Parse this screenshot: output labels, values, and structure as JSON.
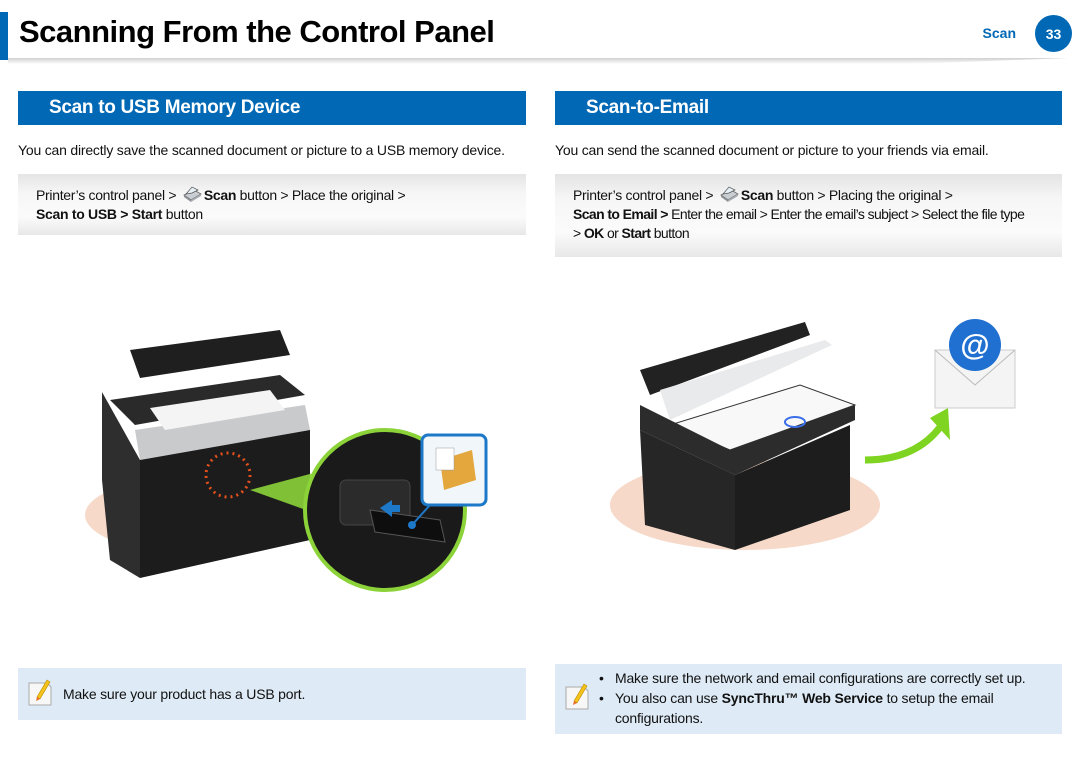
{
  "header": {
    "title": "Scanning From the Control Panel",
    "section": "Scan",
    "page_number": "33",
    "accent_color": "#0068b4"
  },
  "left": {
    "heading": "Scan to USB Memory Device",
    "intro": "You can directly save the scanned document or picture to a USB memory device.",
    "steps": {
      "p1": "Printer’s control panel > ",
      "icon": "scanner-icon",
      "b1": "Scan",
      "p2": " button > Place the original >",
      "b2": "Scan to USB > Start",
      "p3": " button"
    },
    "note": "Make sure your product has a USB port.",
    "illustration": "printer-with-usb-port"
  },
  "right": {
    "heading": "Scan-to-Email",
    "intro": "You can send the scanned document or picture to your friends via email.",
    "steps": {
      "p1": "Printer’s control panel > ",
      "icon": "scanner-icon",
      "b1": "Scan",
      "p2": " button > Placing the original >",
      "b2": "Scan to Email >",
      "p3": " Enter the email > Enter the email’s subject > Select the file type",
      "p4": "> ",
      "b3": "OK",
      "p5": " or ",
      "b4": "Start",
      "p6": " button"
    },
    "notes": [
      {
        "text": "Make sure the network and email configurations are correctly set up."
      },
      {
        "pre": "You also can use ",
        "bold": "SyncThru™ Web Service",
        "post": " to setup the email configurations."
      }
    ],
    "illustration": "printer-to-email"
  }
}
